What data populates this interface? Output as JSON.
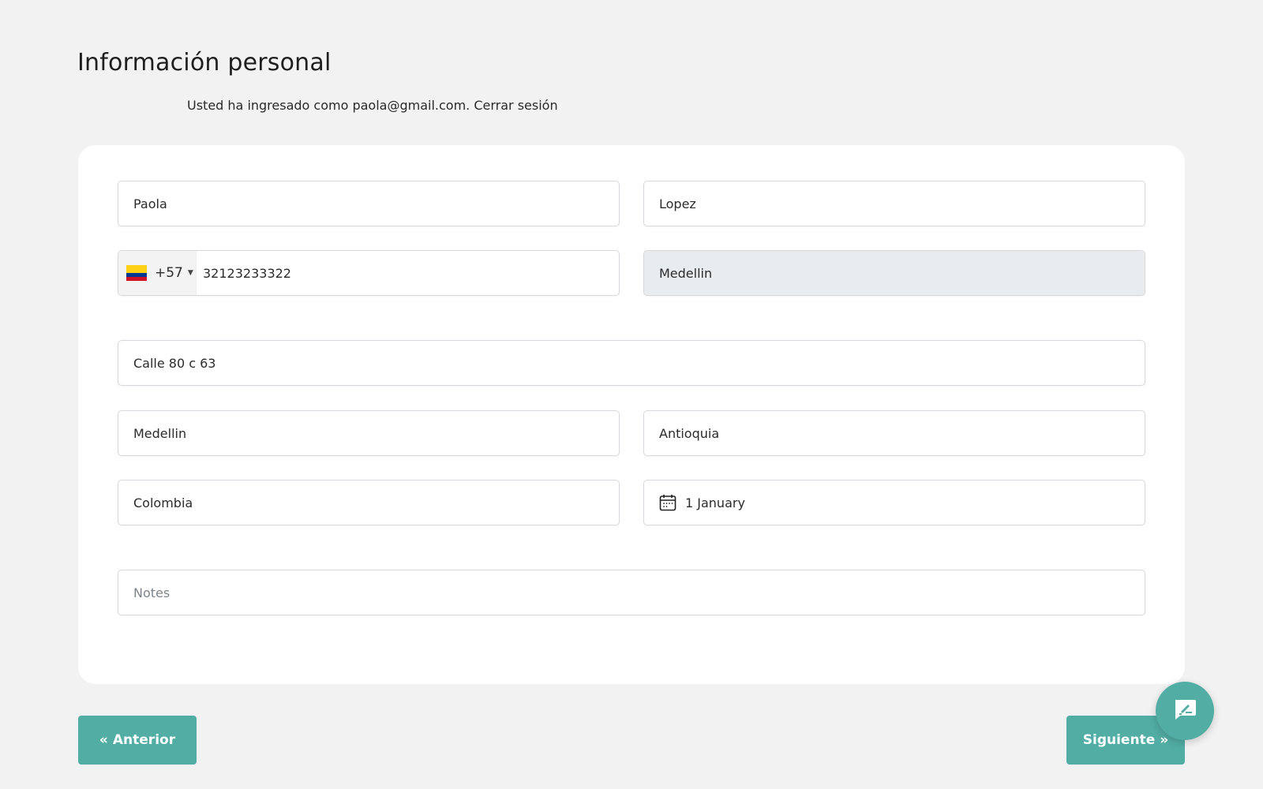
{
  "header": {
    "title": "Información personal",
    "login_prefix": "Usted ha ingresado como paola@gmail.com.",
    "logout_label": "Cerrar sesión"
  },
  "form": {
    "first_name": "Paola",
    "last_name": "Lopez",
    "phone": {
      "country_code": "+57",
      "flag": "colombia-flag-icon",
      "number": "32123233322"
    },
    "city_locked": "Medellin",
    "address": "Calle 80 c 63",
    "city": "Medellin",
    "state": "Antioquia",
    "country": "Colombia",
    "birthday": "1 January",
    "notes_placeholder": "Notes"
  },
  "nav": {
    "prev_label": "Anterior",
    "next_label": "Siguiente",
    "prev_icon": "«",
    "next_icon": "»"
  },
  "chat_button": {
    "icon": "feedback-chat-icon"
  },
  "colors": {
    "accent": "#52ada4",
    "background": "#f2f2f2",
    "card": "#ffffff",
    "disabled_field": "#e9ecef"
  }
}
